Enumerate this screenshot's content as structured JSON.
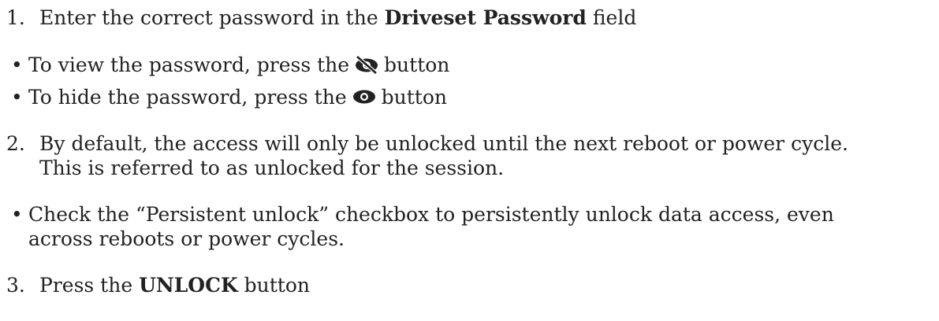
{
  "steps": [
    {
      "number": "1.",
      "pre": "Enter the correct password in the ",
      "bold": "Driveset Password",
      "post": " field"
    },
    {
      "number": "2.",
      "line1": "By default, the access will only be unlocked until the next reboot or power cycle.",
      "line2": "This is referred to as unlocked for the session."
    },
    {
      "number": "3.",
      "pre": "Press the ",
      "bold": "UNLOCK",
      "post": " button"
    }
  ],
  "bullets": {
    "view": {
      "marker": "•",
      "pre": "To view the password, press the",
      "icon": "eye-slash-icon",
      "post": "button"
    },
    "hide": {
      "marker": "•",
      "pre": "To hide the password, press the",
      "icon": "eye-icon",
      "post": "button"
    },
    "persistent": {
      "marker": "•",
      "line1": "Check the “Persistent unlock” checkbox to persistently unlock data access, even",
      "line2": "across reboots or power cycles."
    }
  }
}
